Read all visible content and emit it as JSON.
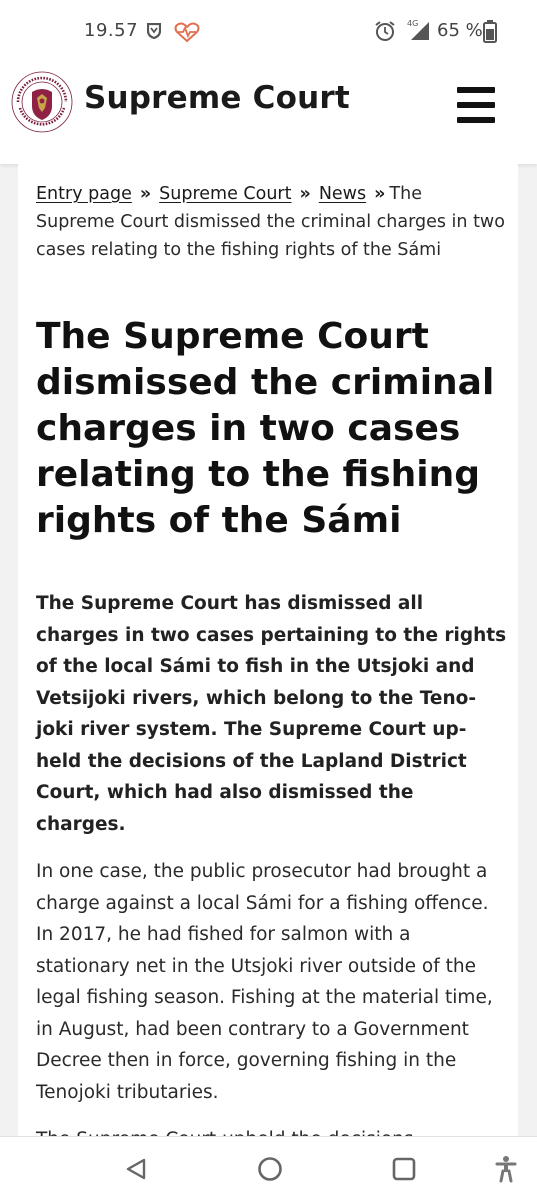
{
  "status_bar": {
    "time": "19.57",
    "network": "4G",
    "battery_percent": "65 %",
    "icons": [
      "shield-icon",
      "health-heart-icon",
      "alarm-icon",
      "signal-icon",
      "battery-icon"
    ]
  },
  "header": {
    "title": "Supreme Court",
    "logo_text": "KORKEIN OIKEUS · HÖGSTA DOMSTOLEN",
    "menu_icon": "hamburger-menu-icon"
  },
  "breadcrumb": {
    "items": [
      {
        "label": "Entry page"
      },
      {
        "label": "Supreme Court"
      },
      {
        "label": "News"
      }
    ],
    "separator": "»",
    "current": "The Supreme Court dismissed the criminal charges in two cases relating to the fishing rights of the Sámi"
  },
  "article": {
    "title": "The Supreme Court dismissed the criminal charges in two cases relating to the fishing rights of the Sámi",
    "lead": "The Supreme Court has dismissed all charges in two cases pertaining to the rights of the local Sámi to fish in the Utsjoki and Vetsijoki rivers, which belong to the Teno-joki river system. The Supreme Court up-held the decisions of the Lapland District Court, which had also dismissed the charges.",
    "paragraphs": [
      "In one case, the public prosecutor had brought a charge against a local Sámi for a fishing offence. In 2017, he had fished for salmon with a stationary net in the Utsjoki river outside of the legal fishing season. Fishing at the material time, in August, had been contrary to a Government Decree then in force, governing fishing in the Tenojoki tributaries.",
      "The Supreme Court upheld the decisions"
    ]
  },
  "nav_bar": {
    "icons": [
      "back-icon",
      "home-icon",
      "recents-icon",
      "accessibility-icon"
    ]
  },
  "colors": {
    "page_background": "#f2f2f2",
    "card_background": "#ffffff",
    "text": "#202020",
    "logo_accent": "#7b1f3a"
  }
}
